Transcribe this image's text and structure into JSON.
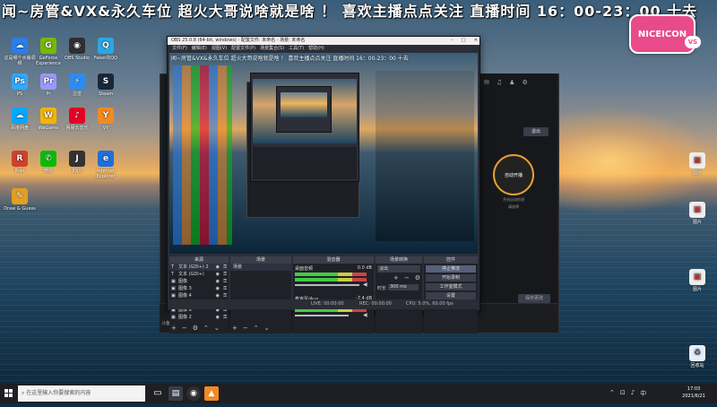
{
  "banner": {
    "text": "闻~房管&VX&永久车位 超火大哥说啥就是啥 ！ 喜欢主播点点关注 直播时间 16：00-23：00 十去"
  },
  "logo": {
    "text": "NICEICON",
    "sub": "VS"
  },
  "desktop_icons": [
    {
      "label": "这是哪个水桶调频",
      "color": "#2b7de9",
      "glyph": "☁"
    },
    {
      "label": "GeForce Experience",
      "color": "#76b900",
      "glyph": "G"
    },
    {
      "label": "OBS Studio",
      "color": "#302e31",
      "glyph": "◉"
    },
    {
      "label": "Faker的QQ",
      "color": "#2aa7e3",
      "glyph": "Q"
    },
    {
      "label": "PS",
      "color": "#31a8ff",
      "glyph": "Ps"
    },
    {
      "label": "Pr",
      "color": "#9999ff",
      "glyph": "Pr"
    },
    {
      "label": "迅雷",
      "color": "#2d8cf0",
      "glyph": "⚡"
    },
    {
      "label": "Steam",
      "color": "#1b2838",
      "glyph": "S"
    },
    {
      "label": "百度网盘",
      "color": "#06a7ff",
      "glyph": "☁"
    },
    {
      "label": "WeGame",
      "color": "#f4b400",
      "glyph": "W"
    },
    {
      "label": "网易云音乐",
      "color": "#e60026",
      "glyph": "♪"
    },
    {
      "label": "VY",
      "color": "#f08a24",
      "glyph": "Y"
    },
    {
      "label": "Rust",
      "color": "#cd412b",
      "glyph": "R"
    },
    {
      "label": "微信",
      "color": "#09bb07",
      "glyph": "✆"
    },
    {
      "label": "JOJO",
      "color": "#333",
      "glyph": "J"
    },
    {
      "label": "Internet Explorer",
      "color": "#1e6fd9",
      "glyph": "e"
    },
    {
      "label": "Draw & Guess",
      "color": "#e0a020",
      "glyph": "✎"
    }
  ],
  "obs": {
    "title": "OBS 25.0.8 (64-bit, windows) - 配置文件: 未命名 - 场景: 未命名",
    "menu": [
      "文件(F)",
      "编辑(E)",
      "视图(V)",
      "配置文件(P)",
      "场景集合(S)",
      "工具(T)",
      "帮助(H)"
    ],
    "docks": {
      "sources": "来源",
      "scenes": "场景",
      "mixer": "混音器",
      "transitions": "场景转换",
      "controls": "控件"
    },
    "sources": [
      "文本 (GDI+) 2",
      "文本 (GDI+)",
      "图像",
      "图像 3",
      "图像 4",
      "图像 5",
      "图像 6",
      "图像 2"
    ],
    "scene_item": "场景",
    "mixer_tracks": [
      {
        "name": "桌面音频",
        "level": "0.0 dB"
      },
      {
        "name": "麦克风/Aux",
        "level": "-7.4 dB"
      }
    ],
    "transition": {
      "type": "淡出",
      "duration_label": "时长",
      "duration": "300 ms"
    },
    "controls": [
      "停止推流",
      "开始录制",
      "工作室模式",
      "设置",
      "退出"
    ],
    "status": {
      "live": "LIVE: 00:00:00",
      "rec": "REC: 00:00:00",
      "cpu": "CPU: 5.0%, 60.00 fps"
    }
  },
  "bg_app": {
    "exit_label": "退出",
    "auto_live_label": "自动开播",
    "sub1": "开启自动检测",
    "sub2": "请选择",
    "save_label": "保存更改",
    "bottom_left": "斗鱼直播伴侣使用教程"
  },
  "taskbar": {
    "search_placeholder": "在这里输入你要搜索的内容",
    "time": "17:03",
    "date": "2021/6/21"
  },
  "right_icons": [
    {
      "label": "图片",
      "color": "#ddd"
    },
    {
      "label": "图片",
      "color": "#ddd"
    },
    {
      "label": "图片",
      "color": "#ddd"
    },
    {
      "label": "回收站",
      "color": "#cce"
    }
  ]
}
